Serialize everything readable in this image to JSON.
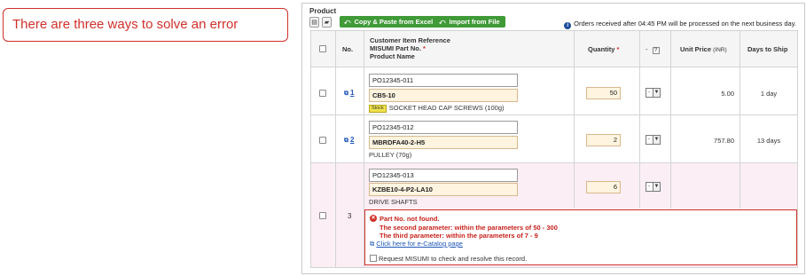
{
  "callout": {
    "text": "There are three ways to solve an error"
  },
  "toolbar": {
    "product_label": "Product",
    "copy_paste_label": "Copy & Paste from Excel",
    "import_label": "Import from File",
    "notice": "Orders received after 04:45 PM will be processed on the next business day."
  },
  "table": {
    "headers": {
      "no": "No.",
      "ref_line1": "Customer Item Reference",
      "ref_line2": "MISUMI Part No.",
      "ref_line3": "Product Name",
      "quantity": "Quantity",
      "required_mark": "*",
      "dash": "-",
      "help": "?",
      "unit_price": "Unit Price",
      "currency": "(INR)",
      "days_to_ship": "Days to Ship"
    },
    "rows": [
      {
        "no": "1",
        "reference": "PO12345-011",
        "part_no": "CB5-10",
        "stock_badge": "Stock",
        "product_name": "SOCKET HEAD CAP SCREWS (100g)",
        "quantity": "50",
        "option": "-",
        "unit_price": "5.00",
        "days": "1 day"
      },
      {
        "no": "2",
        "reference": "PO12345-012",
        "part_no": "MBRDFA40-2-H5",
        "product_name": "PULLEY (70g)",
        "quantity": "2",
        "option": "-",
        "unit_price": "757.80",
        "days": "13 days"
      },
      {
        "no": "3",
        "reference": "PO12345-013",
        "part_no": "KZBE10-4-P2-LA10",
        "product_name": "DRIVE SHAFTS",
        "quantity": "6",
        "option": "-",
        "unit_price": "",
        "days": ""
      }
    ]
  },
  "error": {
    "title": "Part No. not found.",
    "line2": "The second parameter: within the parameters of 50 - 300",
    "line3": "The third parameter: within the parameters of 7 - 9",
    "catalog_link": "Click here for e-Catalog page",
    "request_label": "Request MISUMI to check and resolve this record."
  },
  "colors": {
    "accent_red": "#d0302a",
    "button_green": "#3f9a37",
    "link_blue": "#1f57b8",
    "error_row_bg": "#fbeef5",
    "input_highlight": "#fff4e0"
  }
}
